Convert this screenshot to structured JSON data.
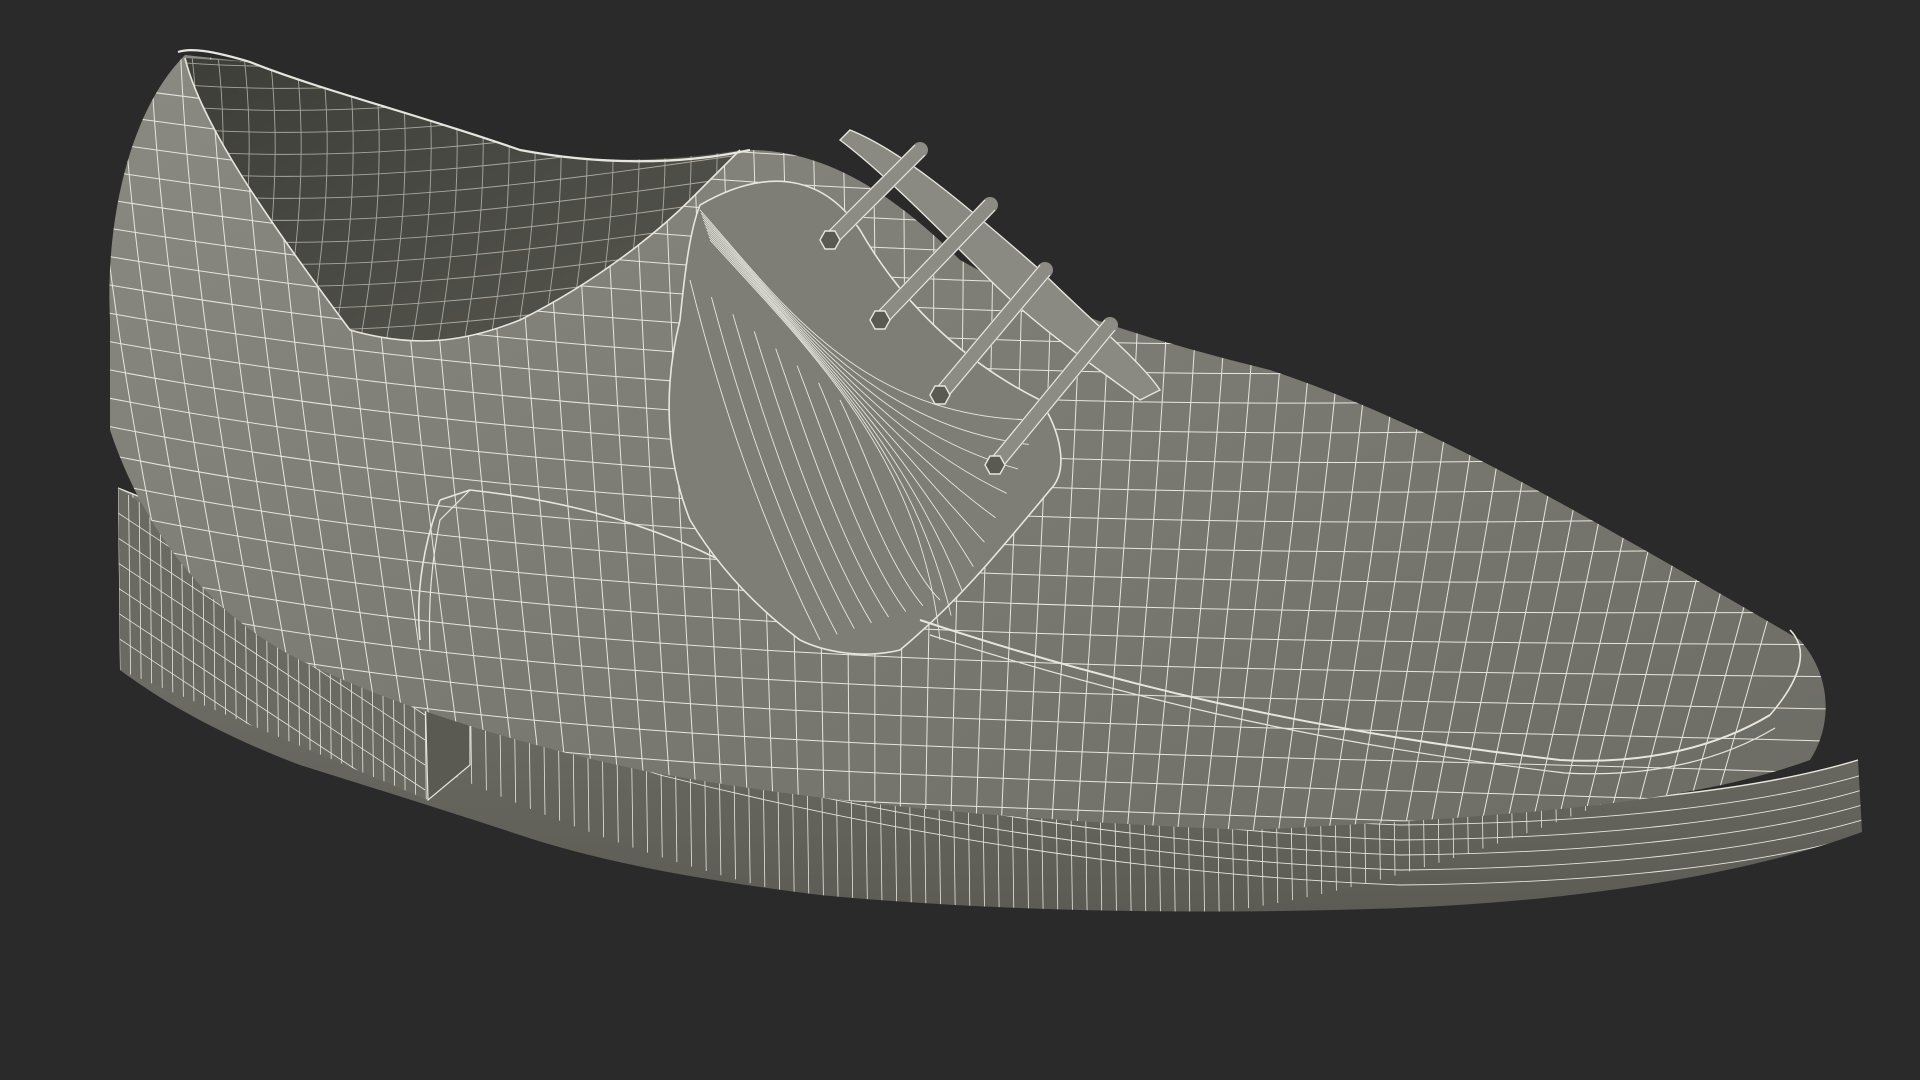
{
  "scene": {
    "subject": "wireframe-shoe",
    "shaded": true,
    "show_wireframe": true,
    "colors": {
      "background": "#2a2a2a",
      "surface": "#787870",
      "surface_light": "#8a8a82",
      "surface_dark": "#5e5e57",
      "interior": "#4a4a44",
      "wire": "#e6e6de"
    }
  }
}
